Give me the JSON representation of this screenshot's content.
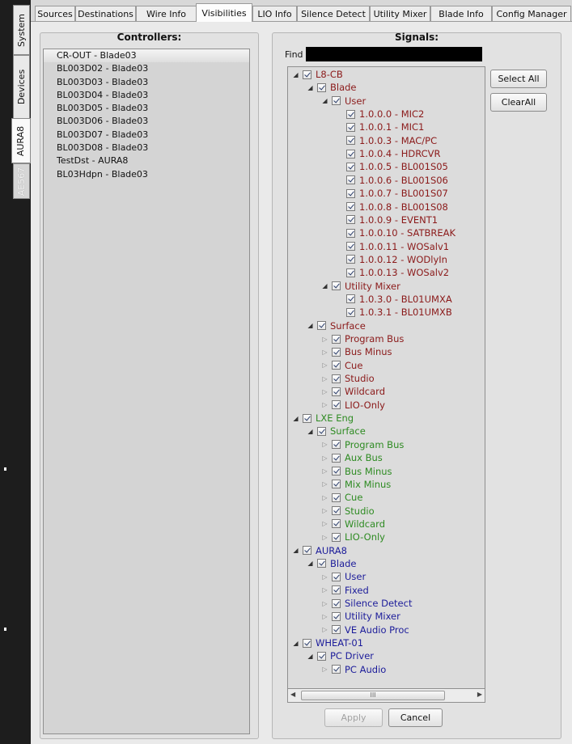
{
  "side_tabs": [
    "System",
    "Devices",
    "AURA8",
    "AE567"
  ],
  "top_tabs": [
    "Sources",
    "Destinations",
    "Wire Info",
    "Visibilities",
    "LIO Info",
    "Silence Detect",
    "Utility Mixer",
    "Blade Info",
    "Config Manager"
  ],
  "controllers": {
    "title": "Controllers:",
    "items": [
      "CR-OUT - Blade03",
      "BL003D02 - Blade03",
      "BL003D03 - Blade03",
      "BL003D04 - Blade03",
      "BL003D05 - Blade03",
      "BL003D06 - Blade03",
      "BL003D07 - Blade03",
      "BL003D08 - Blade03",
      "TestDst - AURA8",
      "BL03Hdpn - Blade03"
    ],
    "selected_index": 0
  },
  "signals": {
    "title": "Signals:",
    "find_label": "Find",
    "find_value": "",
    "select_all": "Select All",
    "clear_all": "ClearAll",
    "apply": "Apply",
    "cancel": "Cancel",
    "scroll_thumb_glyph": "III",
    "tree": [
      {
        "label": "L8-CB",
        "depth": 0,
        "arrow": "expanded",
        "color": "#8b1a1a",
        "checked": true
      },
      {
        "label": "Blade",
        "depth": 1,
        "arrow": "expanded",
        "color": "#8b1a1a",
        "checked": true
      },
      {
        "label": "User",
        "depth": 2,
        "arrow": "expanded",
        "color": "#8b1a1a",
        "checked": true
      },
      {
        "label": "1.0.0.0 - MIC2",
        "depth": 3,
        "arrow": "none",
        "color": "#8b1a1a",
        "checked": true
      },
      {
        "label": "1.0.0.1 - MIC1",
        "depth": 3,
        "arrow": "none",
        "color": "#8b1a1a",
        "checked": true
      },
      {
        "label": "1.0.0.3 - MAC/PC",
        "depth": 3,
        "arrow": "none",
        "color": "#8b1a1a",
        "checked": true
      },
      {
        "label": "1.0.0.4 - HDRCVR",
        "depth": 3,
        "arrow": "none",
        "color": "#8b1a1a",
        "checked": true
      },
      {
        "label": "1.0.0.5 - BL001S05",
        "depth": 3,
        "arrow": "none",
        "color": "#8b1a1a",
        "checked": true
      },
      {
        "label": "1.0.0.6 - BL001S06",
        "depth": 3,
        "arrow": "none",
        "color": "#8b1a1a",
        "checked": true
      },
      {
        "label": "1.0.0.7 - BL001S07",
        "depth": 3,
        "arrow": "none",
        "color": "#8b1a1a",
        "checked": true
      },
      {
        "label": "1.0.0.8 - BL001S08",
        "depth": 3,
        "arrow": "none",
        "color": "#8b1a1a",
        "checked": true
      },
      {
        "label": "1.0.0.9 - EVENT1",
        "depth": 3,
        "arrow": "none",
        "color": "#8b1a1a",
        "checked": true
      },
      {
        "label": "1.0.0.10 - SATBREAK",
        "depth": 3,
        "arrow": "none",
        "color": "#8b1a1a",
        "checked": true
      },
      {
        "label": "1.0.0.11 - WOSalv1",
        "depth": 3,
        "arrow": "none",
        "color": "#8b1a1a",
        "checked": true
      },
      {
        "label": "1.0.0.12 - WODlyIn",
        "depth": 3,
        "arrow": "none",
        "color": "#8b1a1a",
        "checked": true
      },
      {
        "label": "1.0.0.13 - WOSalv2",
        "depth": 3,
        "arrow": "none",
        "color": "#8b1a1a",
        "checked": true
      },
      {
        "label": "Utility Mixer",
        "depth": 2,
        "arrow": "expanded",
        "color": "#8b1a1a",
        "checked": true
      },
      {
        "label": "1.0.3.0 - BL01UMXA",
        "depth": 3,
        "arrow": "none",
        "color": "#8b1a1a",
        "checked": true
      },
      {
        "label": "1.0.3.1 - BL01UMXB",
        "depth": 3,
        "arrow": "none",
        "color": "#8b1a1a",
        "checked": true
      },
      {
        "label": "Surface",
        "depth": 1,
        "arrow": "expanded",
        "color": "#8b1a1a",
        "checked": true
      },
      {
        "label": "Program Bus",
        "depth": 2,
        "arrow": "collapsed",
        "color": "#8b1a1a",
        "checked": true
      },
      {
        "label": "Bus Minus",
        "depth": 2,
        "arrow": "collapsed",
        "color": "#8b1a1a",
        "checked": true
      },
      {
        "label": "Cue",
        "depth": 2,
        "arrow": "collapsed",
        "color": "#8b1a1a",
        "checked": true
      },
      {
        "label": "Studio",
        "depth": 2,
        "arrow": "collapsed",
        "color": "#8b1a1a",
        "checked": true
      },
      {
        "label": "Wildcard",
        "depth": 2,
        "arrow": "collapsed",
        "color": "#8b1a1a",
        "checked": true
      },
      {
        "label": "LIO-Only",
        "depth": 2,
        "arrow": "collapsed",
        "color": "#8b1a1a",
        "checked": true
      },
      {
        "label": "LXE Eng",
        "depth": 0,
        "arrow": "expanded",
        "color": "#2e8b22",
        "checked": true
      },
      {
        "label": "Surface",
        "depth": 1,
        "arrow": "expanded",
        "color": "#2e8b22",
        "checked": true
      },
      {
        "label": "Program Bus",
        "depth": 2,
        "arrow": "collapsed",
        "color": "#2e8b22",
        "checked": true
      },
      {
        "label": "Aux Bus",
        "depth": 2,
        "arrow": "collapsed",
        "color": "#2e8b22",
        "checked": true
      },
      {
        "label": "Bus Minus",
        "depth": 2,
        "arrow": "collapsed",
        "color": "#2e8b22",
        "checked": true
      },
      {
        "label": "Mix Minus",
        "depth": 2,
        "arrow": "collapsed",
        "color": "#2e8b22",
        "checked": true
      },
      {
        "label": "Cue",
        "depth": 2,
        "arrow": "collapsed",
        "color": "#2e8b22",
        "checked": true
      },
      {
        "label": "Studio",
        "depth": 2,
        "arrow": "collapsed",
        "color": "#2e8b22",
        "checked": true
      },
      {
        "label": "Wildcard",
        "depth": 2,
        "arrow": "collapsed",
        "color": "#2e8b22",
        "checked": true
      },
      {
        "label": "LIO-Only",
        "depth": 2,
        "arrow": "collapsed",
        "color": "#2e8b22",
        "checked": true
      },
      {
        "label": "AURA8",
        "depth": 0,
        "arrow": "expanded",
        "color": "#1c1c9a",
        "checked": true
      },
      {
        "label": "Blade",
        "depth": 1,
        "arrow": "expanded",
        "color": "#1c1c9a",
        "checked": true
      },
      {
        "label": "User",
        "depth": 2,
        "arrow": "collapsed",
        "color": "#1c1c9a",
        "checked": true
      },
      {
        "label": "Fixed",
        "depth": 2,
        "arrow": "collapsed",
        "color": "#1c1c9a",
        "checked": true
      },
      {
        "label": "Silence Detect",
        "depth": 2,
        "arrow": "collapsed",
        "color": "#1c1c9a",
        "checked": true
      },
      {
        "label": "Utility Mixer",
        "depth": 2,
        "arrow": "collapsed",
        "color": "#1c1c9a",
        "checked": true
      },
      {
        "label": "VE Audio Proc",
        "depth": 2,
        "arrow": "collapsed",
        "color": "#1c1c9a",
        "checked": true
      },
      {
        "label": "WHEAT-01",
        "depth": 0,
        "arrow": "expanded",
        "color": "#1c1c9a",
        "checked": true
      },
      {
        "label": "PC Driver",
        "depth": 1,
        "arrow": "expanded",
        "color": "#1c1c9a",
        "checked": true
      },
      {
        "label": "PC Audio",
        "depth": 2,
        "arrow": "collapsed",
        "color": "#1c1c9a",
        "checked": true
      }
    ]
  }
}
